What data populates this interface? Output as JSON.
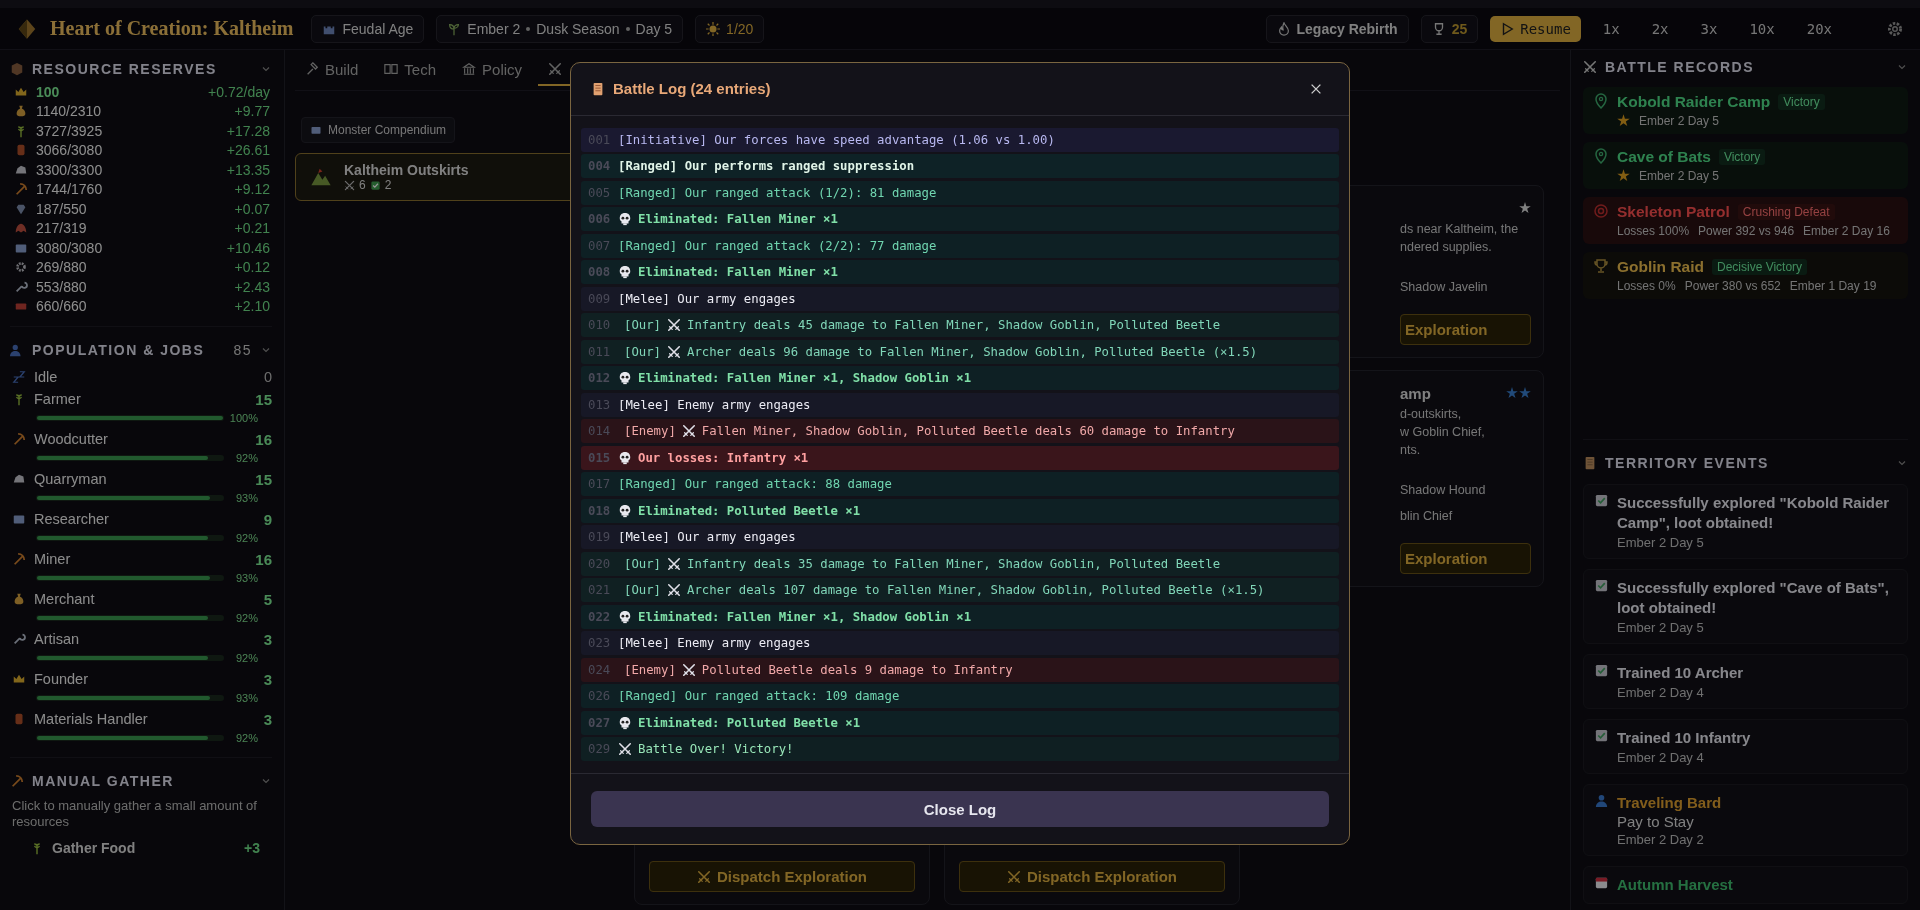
{
  "top_bar": {
    "title": "Heart of Creation: Kaltheim",
    "era": "Feudal Age",
    "calendar": [
      "Ember 2",
      "Dusk Season",
      "Day 5"
    ],
    "sun": "1/20",
    "legacy": "Legacy Rebirth",
    "trophies": "25",
    "resume": "Resume",
    "speeds": [
      {
        "label": "1x",
        "selected": false
      },
      {
        "label": "2x",
        "selected": false
      },
      {
        "label": "3x",
        "selected": false
      },
      {
        "label": "10x",
        "selected": false
      },
      {
        "label": "20x",
        "selected": false
      }
    ]
  },
  "resources": {
    "title": "RESOURCE RESERVES",
    "items": [
      {
        "value": "100",
        "rate": "+0.72/day"
      },
      {
        "value": "1140/2310",
        "rate": "+9.77"
      },
      {
        "value": "3727/3925",
        "rate": "+17.28"
      },
      {
        "value": "3066/3080",
        "rate": "+26.61"
      },
      {
        "value": "3300/3300",
        "rate": "+13.35"
      },
      {
        "value": "1744/1760",
        "rate": "+9.12"
      },
      {
        "value": "187/550",
        "rate": "+0.07"
      },
      {
        "value": "217/319",
        "rate": "+0.21"
      },
      {
        "value": "3080/3080",
        "rate": "+10.46"
      },
      {
        "value": "269/880",
        "rate": "+0.12"
      },
      {
        "value": "553/880",
        "rate": "+2.43"
      },
      {
        "value": "660/660",
        "rate": "+2.10"
      }
    ]
  },
  "population": {
    "title": "POPULATION & JOBS",
    "total": "85",
    "idle": {
      "label": "Idle",
      "count": "0"
    },
    "jobs": [
      {
        "name": "Farmer",
        "count": "15",
        "level": 1.0,
        "percent": "100%"
      },
      {
        "name": "Woodcutter",
        "count": "16",
        "level": 0.92,
        "percent": "92%"
      },
      {
        "name": "Quarryman",
        "count": "15",
        "level": 0.93,
        "percent": "93%"
      },
      {
        "name": "Researcher",
        "count": "9",
        "level": 0.92,
        "percent": "92%"
      },
      {
        "name": "Miner",
        "count": "16",
        "level": 0.93,
        "percent": "93%"
      },
      {
        "name": "Merchant",
        "count": "5",
        "level": 0.92,
        "percent": "92%"
      },
      {
        "name": "Artisan",
        "count": "3",
        "level": 0.92,
        "percent": "92%"
      },
      {
        "name": "Founder",
        "count": "3",
        "level": 0.93,
        "percent": "93%"
      },
      {
        "name": "Materials Handler",
        "count": "3",
        "level": 0.92,
        "percent": "92%"
      }
    ]
  },
  "manual_gather": {
    "title": "MANUAL GATHER",
    "hint": "Click to manually gather a small amount of resources",
    "actions": [
      {
        "label": "Gather Food",
        "amount": "+3"
      }
    ]
  },
  "tabs": [
    {
      "label": "Build",
      "selected": false
    },
    {
      "label": "Tech",
      "selected": false
    },
    {
      "label": "Policy",
      "selected": false
    },
    {
      "selected": true
    }
  ],
  "exploration": {
    "subtab": "Monster Compendium",
    "regions": [
      {
        "name": "Kaltheim Outskirts",
        "troops": "6",
        "cleared": "2",
        "selected": true
      }
    ],
    "partial_cards": [
      {
        "kind": "normal",
        "lines": [
          "ds near Kaltheim, the",
          "ndered supplies."
        ],
        "enemies": [
          "Shadow Javelin"
        ],
        "button": "Exploration"
      },
      {
        "title": "amp",
        "kind": "hard",
        "lines": [
          "d-outskirts,",
          "w Goblin Chief,",
          "nts."
        ],
        "enemies": [
          "Shadow Hound",
          "blin Chief"
        ],
        "button": "Exploration"
      }
    ],
    "dispatch_buttons": [
      "Dispatch Exploration",
      "Dispatch Exploration"
    ]
  },
  "battle_records": {
    "title": "BATTLE RECORDS",
    "items": [
      {
        "kind": "explore",
        "name": "Kobold Raider Camp",
        "result": "Victory",
        "details": [
          "Ember 2 Day 5"
        ]
      },
      {
        "kind": "explore",
        "name": "Cave of Bats",
        "result": "Victory",
        "details": [
          "Ember 2 Day 5"
        ]
      },
      {
        "kind": "defense",
        "name": "Skeleton Patrol",
        "result": "Crushing Defeat",
        "details": [
          "Losses 100%",
          "Power 392 vs 946",
          "Ember 2 Day 16"
        ]
      },
      {
        "kind": "raid",
        "name": "Goblin Raid",
        "result": "Decisive Victory",
        "details": [
          "Losses 0%",
          "Power 380 vs 652",
          "Ember 1 Day 19"
        ]
      }
    ]
  },
  "territory_events": {
    "title": "TERRITORY EVENTS",
    "items": [
      {
        "kind": "note",
        "title": "Successfully explored \"Kobold Raider Camp\", loot obtained!",
        "date": "Ember 2 Day 5"
      },
      {
        "kind": "note",
        "title": "Successfully explored \"Cave of Bats\", loot obtained!",
        "date": "Ember 2 Day 5"
      },
      {
        "kind": "note",
        "title": "Trained 10 Archer",
        "date": "Ember 2 Day 4"
      },
      {
        "kind": "note",
        "title": "Trained 10 Infantry",
        "date": "Ember 2 Day 4"
      },
      {
        "kind": "visitor",
        "title": "Traveling Bard",
        "subtitle": "Pay to Stay",
        "date": "Ember 2 Day 2"
      },
      {
        "kind": "season",
        "title": "Autumn Harvest"
      }
    ]
  },
  "battle_log": {
    "title": "Battle Log (24 entries)",
    "close_button": "Close Log",
    "entries": [
      {
        "num": "001",
        "kind": "initiative",
        "text": "[Initiative] Our forces have speed advantage (1.06 vs 1.00)"
      },
      {
        "num": "004",
        "kind": "ranged_bold",
        "text": "[Ranged] Our performs ranged suppression"
      },
      {
        "num": "005",
        "kind": "ranged",
        "text": "[Ranged] Our ranged attack (1/2): 81 damage"
      },
      {
        "num": "006",
        "kind": "kill",
        "text": "Eliminated: Fallen Miner ×1"
      },
      {
        "num": "007",
        "kind": "ranged",
        "text": "[Ranged] Our ranged attack (2/2): 77 damage"
      },
      {
        "num": "008",
        "kind": "kill",
        "text": "Eliminated: Fallen Miner ×1"
      },
      {
        "num": "009",
        "kind": "melee",
        "text": "[Melee] Our army engages"
      },
      {
        "num": "010",
        "kind": "our_attack",
        "prefix": "[Our]",
        "text": "Infantry deals 45 damage to Fallen Miner, Shadow Goblin, Polluted Beetle"
      },
      {
        "num": "011",
        "kind": "our_attack",
        "prefix": "[Our]",
        "text": "Archer deals 96 damage to Fallen Miner, Shadow Goblin, Polluted Beetle (×1.5)"
      },
      {
        "num": "012",
        "kind": "kill",
        "text": "Eliminated: Fallen Miner ×1, Shadow Goblin ×1"
      },
      {
        "num": "013",
        "kind": "melee",
        "text": "[Melee] Enemy army engages"
      },
      {
        "num": "014",
        "kind": "enemy_attack",
        "prefix": "[Enemy]",
        "text": "Fallen Miner, Shadow Goblin, Polluted Beetle deals 60 damage to Infantry"
      },
      {
        "num": "015",
        "kind": "loss",
        "text": "Our losses: Infantry ×1"
      },
      {
        "num": "017",
        "kind": "ranged",
        "text": "[Ranged] Our ranged attack: 88 damage"
      },
      {
        "num": "018",
        "kind": "kill",
        "text": "Eliminated: Polluted Beetle ×1"
      },
      {
        "num": "019",
        "kind": "melee",
        "text": "[Melee] Our army engages"
      },
      {
        "num": "020",
        "kind": "our_attack",
        "prefix": "[Our]",
        "text": "Infantry deals 35 damage to Fallen Miner, Shadow Goblin, Polluted Beetle"
      },
      {
        "num": "021",
        "kind": "our_attack",
        "prefix": "[Our]",
        "text": "Archer deals 107 damage to Fallen Miner, Shadow Goblin, Polluted Beetle (×1.5)"
      },
      {
        "num": "022",
        "kind": "kill",
        "text": "Eliminated: Fallen Miner ×1, Shadow Goblin ×1"
      },
      {
        "num": "023",
        "kind": "melee",
        "text": "[Melee] Enemy army engages"
      },
      {
        "num": "024",
        "kind": "enemy_attack",
        "prefix": "[Enemy]",
        "text": "Polluted Beetle deals 9 damage to Infantry"
      },
      {
        "num": "026",
        "kind": "ranged",
        "text": "[Ranged] Our ranged attack: 109 damage"
      },
      {
        "num": "027",
        "kind": "kill",
        "text": "Eliminated: Polluted Beetle ×1"
      },
      {
        "num": "029",
        "kind": "end",
        "text": "Battle Over! Victory!"
      }
    ]
  }
}
